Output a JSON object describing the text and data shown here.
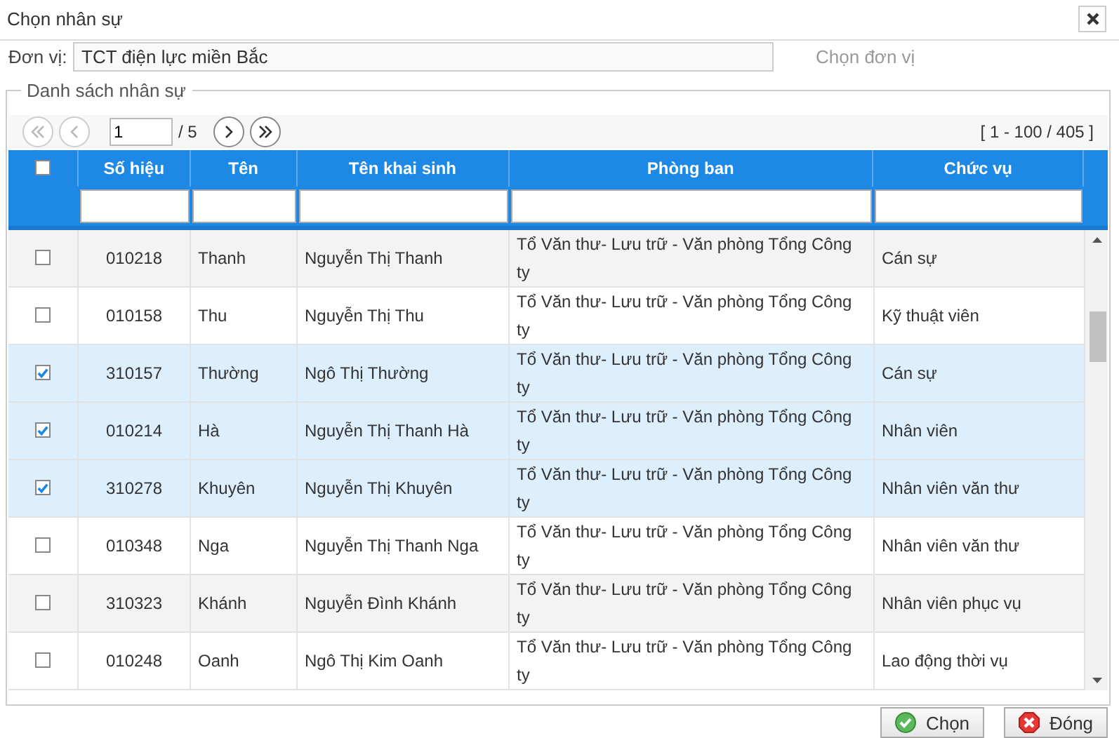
{
  "window": {
    "title": "Chọn nhân sự"
  },
  "unit": {
    "label": "Đơn vị:",
    "value": "TCT điện lực miền Bắc",
    "action": "Chọn đơn vị"
  },
  "fieldset": {
    "legend": "Danh sách nhân sự"
  },
  "pager": {
    "buttons": [
      {
        "kind": "first",
        "disabled": true
      },
      {
        "kind": "prev",
        "disabled": true
      },
      {
        "kind": "next",
        "disabled": false
      },
      {
        "kind": "last",
        "disabled": false
      }
    ],
    "page": "1",
    "total": "/ 5",
    "range": "[ 1 - 100 / 405 ]"
  },
  "table": {
    "header_checkbox": {
      "checked": false
    },
    "columns": [
      "Số hiệu",
      "Tên",
      "Tên khai sinh",
      "Phòng ban",
      "Chức vụ"
    ],
    "rows": [
      {
        "selected": false,
        "cells": [
          "010218",
          "Thanh",
          "Nguyễn Thị Thanh",
          "Tổ Văn thư- Lưu trữ - Văn phòng Tổng Công ty",
          "Cán sự"
        ]
      },
      {
        "selected": false,
        "cells": [
          "010158",
          "Thu",
          "Nguyễn Thị Thu",
          "Tổ Văn thư- Lưu trữ - Văn phòng Tổng Công ty",
          "Kỹ thuật viên"
        ]
      },
      {
        "selected": true,
        "cells": [
          "310157",
          "Thường",
          "Ngô Thị Thường",
          "Tổ Văn thư- Lưu trữ - Văn phòng Tổng Công ty",
          "Cán sự"
        ]
      },
      {
        "selected": true,
        "cells": [
          "010214",
          "Hà",
          "Nguyễn Thị Thanh Hà",
          "Tổ Văn thư- Lưu trữ - Văn phòng Tổng Công ty",
          "Nhân viên"
        ]
      },
      {
        "selected": true,
        "cells": [
          "310278",
          "Khuyên",
          "Nguyễn Thị Khuyên",
          "Tổ Văn thư- Lưu trữ - Văn phòng Tổng Công ty",
          "Nhân viên văn thư"
        ]
      },
      {
        "selected": false,
        "cells": [
          "010348",
          "Nga",
          "Nguyễn Thị Thanh Nga",
          "Tổ Văn thư- Lưu trữ - Văn phòng Tổng Công ty",
          "Nhân viên văn thư"
        ]
      },
      {
        "selected": false,
        "cells": [
          "310323",
          "Khánh",
          "Nguyễn Đình Khánh",
          "Tổ Văn thư- Lưu trữ - Văn phòng Tổng Công ty",
          "Nhân viên phục vụ"
        ]
      },
      {
        "selected": false,
        "cells": [
          "010248",
          "Oanh",
          "Ngô Thị Kim Oanh",
          "Tổ Văn thư- Lưu trữ - Văn phòng Tổng Công ty",
          "Lao động thời vụ"
        ]
      }
    ]
  },
  "buttons": [
    {
      "kind": "ok",
      "label": "Chọn"
    },
    {
      "kind": "close",
      "label": "Đóng"
    }
  ]
}
